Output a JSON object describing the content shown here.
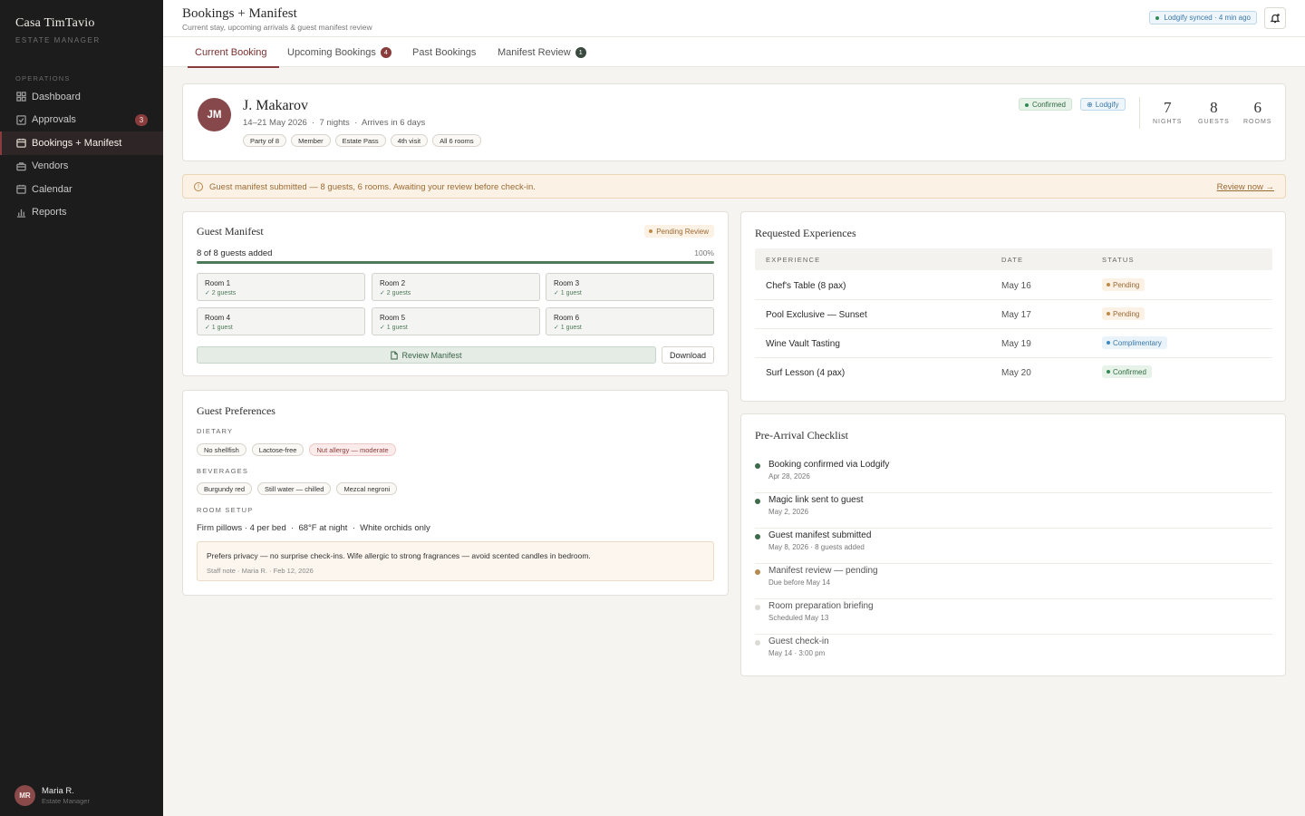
{
  "app": {
    "brand": "Casa TimTavio",
    "subtitle": "ESTATE MANAGER"
  },
  "sidebar": {
    "section": "OPERATIONS",
    "items": [
      {
        "label": "Dashboard",
        "icon": "grid-icon"
      },
      {
        "label": "Approvals",
        "icon": "check-square-icon",
        "badge": "3"
      },
      {
        "label": "Bookings + Manifest",
        "icon": "calendar-icon",
        "active": true
      },
      {
        "label": "Vendors",
        "icon": "briefcase-icon"
      },
      {
        "label": "Calendar",
        "icon": "calendar-icon"
      },
      {
        "label": "Reports",
        "icon": "bar-chart-icon"
      }
    ],
    "user": {
      "initials": "MR",
      "name": "Maria R.",
      "role": "Estate Manager"
    }
  },
  "header": {
    "title": "Bookings + Manifest",
    "subtitle": "Current stay, upcoming arrivals & guest manifest review",
    "sync": "Lodgify synced · 4 min ago"
  },
  "tabs": [
    {
      "label": "Current Booking"
    },
    {
      "label": "Upcoming Bookings",
      "count": "4"
    },
    {
      "label": "Past Bookings"
    },
    {
      "label": "Manifest Review",
      "count": "1"
    }
  ],
  "booking": {
    "initials": "JM",
    "name": "J. Makarov",
    "dates": "14–21 May 2026",
    "nights_text": "7 nights",
    "arrives": "Arrives in 6 days",
    "chips": [
      "Party of 8",
      "Member",
      "Estate Pass",
      "4th visit",
      "All 6 rooms"
    ],
    "status": "Confirmed",
    "source": "Lodgify",
    "stats": [
      {
        "num": "7",
        "label": "NIGHTS"
      },
      {
        "num": "8",
        "label": "GUESTS"
      },
      {
        "num": "6",
        "label": "ROOMS"
      }
    ]
  },
  "alert": {
    "text": "Guest manifest submitted — 8 guests, 6 rooms. Awaiting your review before check-in.",
    "link": "Review now →"
  },
  "manifest": {
    "title": "Guest Manifest",
    "status": "Pending Review",
    "progress_label": "8 of 8 guests added",
    "progress_pct": "100%",
    "progress_value": 100,
    "rooms": [
      {
        "name": "Room 1",
        "guests": "✓ 2 guests"
      },
      {
        "name": "Room 2",
        "guests": "✓ 2 guests"
      },
      {
        "name": "Room 3",
        "guests": "✓ 1 guest"
      },
      {
        "name": "Room 4",
        "guests": "✓ 1 guest"
      },
      {
        "name": "Room 5",
        "guests": "✓ 1 guest"
      },
      {
        "name": "Room 6",
        "guests": "✓ 1 guest"
      }
    ],
    "review_btn": "Review Manifest",
    "download_btn": "Download"
  },
  "preferences": {
    "title": "Guest Preferences",
    "dietary_label": "DIETARY",
    "dietary": [
      "No shellfish",
      "Lactose-free",
      "Nut allergy — moderate"
    ],
    "beverages_label": "BEVERAGES",
    "beverages": [
      "Burgundy red",
      "Still water — chilled",
      "Mezcal negroni"
    ],
    "room_setup_label": "ROOM SETUP",
    "room_setup": "Firm pillows · 4 per bed  ·  68°F at night  ·  White orchids only",
    "note": "Prefers privacy — no surprise check-ins. Wife allergic to strong fragrances — avoid scented candles in bedroom.",
    "note_meta": "Staff note · Maria R. · Feb 12, 2026"
  },
  "experiences": {
    "title": "Requested Experiences",
    "columns": [
      "EXPERIENCE",
      "DATE",
      "STATUS"
    ],
    "rows": [
      {
        "name": "Chef's Table (8 pax)",
        "date": "May 16",
        "status": "Pending"
      },
      {
        "name": "Pool Exclusive — Sunset",
        "date": "May 17",
        "status": "Pending"
      },
      {
        "name": "Wine Vault Tasting",
        "date": "May 19",
        "status": "Complimentary"
      },
      {
        "name": "Surf Lesson (4 pax)",
        "date": "May 20",
        "status": "Confirmed"
      }
    ]
  },
  "checklist": {
    "title": "Pre-Arrival Checklist",
    "items": [
      {
        "title": "Booking confirmed via Lodgify",
        "sub": "Apr 28, 2026",
        "state": "done"
      },
      {
        "title": "Magic link sent to guest",
        "sub": "May 2, 2026",
        "state": "done"
      },
      {
        "title": "Guest manifest submitted",
        "sub": "May 8, 2026 · 8 guests added",
        "state": "done"
      },
      {
        "title": "Manifest review — pending",
        "sub": "Due before May 14",
        "state": "pending"
      },
      {
        "title": "Room preparation briefing",
        "sub": "Scheduled May 13",
        "state": "todo"
      },
      {
        "title": "Guest check-in",
        "sub": "May 14 · 3:00 pm",
        "state": "todo"
      }
    ]
  },
  "colors": {
    "accent": "#8a3c3c",
    "sidebar": "#1c1c1c",
    "success": "#3d6b4a"
  }
}
